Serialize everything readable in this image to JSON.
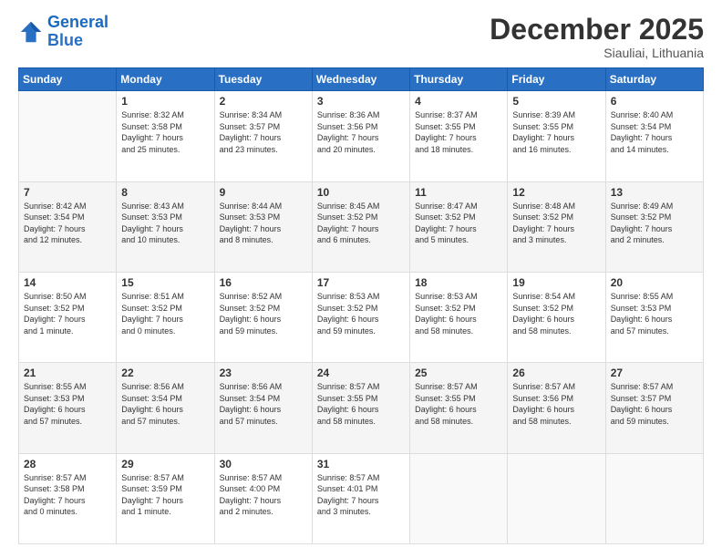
{
  "header": {
    "logo_line1": "General",
    "logo_line2": "Blue",
    "month": "December 2025",
    "location": "Siauliai, Lithuania"
  },
  "weekdays": [
    "Sunday",
    "Monday",
    "Tuesday",
    "Wednesday",
    "Thursday",
    "Friday",
    "Saturday"
  ],
  "weeks": [
    [
      {
        "day": "",
        "info": ""
      },
      {
        "day": "1",
        "info": "Sunrise: 8:32 AM\nSunset: 3:58 PM\nDaylight: 7 hours\nand 25 minutes."
      },
      {
        "day": "2",
        "info": "Sunrise: 8:34 AM\nSunset: 3:57 PM\nDaylight: 7 hours\nand 23 minutes."
      },
      {
        "day": "3",
        "info": "Sunrise: 8:36 AM\nSunset: 3:56 PM\nDaylight: 7 hours\nand 20 minutes."
      },
      {
        "day": "4",
        "info": "Sunrise: 8:37 AM\nSunset: 3:55 PM\nDaylight: 7 hours\nand 18 minutes."
      },
      {
        "day": "5",
        "info": "Sunrise: 8:39 AM\nSunset: 3:55 PM\nDaylight: 7 hours\nand 16 minutes."
      },
      {
        "day": "6",
        "info": "Sunrise: 8:40 AM\nSunset: 3:54 PM\nDaylight: 7 hours\nand 14 minutes."
      }
    ],
    [
      {
        "day": "7",
        "info": "Sunrise: 8:42 AM\nSunset: 3:54 PM\nDaylight: 7 hours\nand 12 minutes."
      },
      {
        "day": "8",
        "info": "Sunrise: 8:43 AM\nSunset: 3:53 PM\nDaylight: 7 hours\nand 10 minutes."
      },
      {
        "day": "9",
        "info": "Sunrise: 8:44 AM\nSunset: 3:53 PM\nDaylight: 7 hours\nand 8 minutes."
      },
      {
        "day": "10",
        "info": "Sunrise: 8:45 AM\nSunset: 3:52 PM\nDaylight: 7 hours\nand 6 minutes."
      },
      {
        "day": "11",
        "info": "Sunrise: 8:47 AM\nSunset: 3:52 PM\nDaylight: 7 hours\nand 5 minutes."
      },
      {
        "day": "12",
        "info": "Sunrise: 8:48 AM\nSunset: 3:52 PM\nDaylight: 7 hours\nand 3 minutes."
      },
      {
        "day": "13",
        "info": "Sunrise: 8:49 AM\nSunset: 3:52 PM\nDaylight: 7 hours\nand 2 minutes."
      }
    ],
    [
      {
        "day": "14",
        "info": "Sunrise: 8:50 AM\nSunset: 3:52 PM\nDaylight: 7 hours\nand 1 minute."
      },
      {
        "day": "15",
        "info": "Sunrise: 8:51 AM\nSunset: 3:52 PM\nDaylight: 7 hours\nand 0 minutes."
      },
      {
        "day": "16",
        "info": "Sunrise: 8:52 AM\nSunset: 3:52 PM\nDaylight: 6 hours\nand 59 minutes."
      },
      {
        "day": "17",
        "info": "Sunrise: 8:53 AM\nSunset: 3:52 PM\nDaylight: 6 hours\nand 59 minutes."
      },
      {
        "day": "18",
        "info": "Sunrise: 8:53 AM\nSunset: 3:52 PM\nDaylight: 6 hours\nand 58 minutes."
      },
      {
        "day": "19",
        "info": "Sunrise: 8:54 AM\nSunset: 3:52 PM\nDaylight: 6 hours\nand 58 minutes."
      },
      {
        "day": "20",
        "info": "Sunrise: 8:55 AM\nSunset: 3:53 PM\nDaylight: 6 hours\nand 57 minutes."
      }
    ],
    [
      {
        "day": "21",
        "info": "Sunrise: 8:55 AM\nSunset: 3:53 PM\nDaylight: 6 hours\nand 57 minutes."
      },
      {
        "day": "22",
        "info": "Sunrise: 8:56 AM\nSunset: 3:54 PM\nDaylight: 6 hours\nand 57 minutes."
      },
      {
        "day": "23",
        "info": "Sunrise: 8:56 AM\nSunset: 3:54 PM\nDaylight: 6 hours\nand 57 minutes."
      },
      {
        "day": "24",
        "info": "Sunrise: 8:57 AM\nSunset: 3:55 PM\nDaylight: 6 hours\nand 58 minutes."
      },
      {
        "day": "25",
        "info": "Sunrise: 8:57 AM\nSunset: 3:55 PM\nDaylight: 6 hours\nand 58 minutes."
      },
      {
        "day": "26",
        "info": "Sunrise: 8:57 AM\nSunset: 3:56 PM\nDaylight: 6 hours\nand 58 minutes."
      },
      {
        "day": "27",
        "info": "Sunrise: 8:57 AM\nSunset: 3:57 PM\nDaylight: 6 hours\nand 59 minutes."
      }
    ],
    [
      {
        "day": "28",
        "info": "Sunrise: 8:57 AM\nSunset: 3:58 PM\nDaylight: 7 hours\nand 0 minutes."
      },
      {
        "day": "29",
        "info": "Sunrise: 8:57 AM\nSunset: 3:59 PM\nDaylight: 7 hours\nand 1 minute."
      },
      {
        "day": "30",
        "info": "Sunrise: 8:57 AM\nSunset: 4:00 PM\nDaylight: 7 hours\nand 2 minutes."
      },
      {
        "day": "31",
        "info": "Sunrise: 8:57 AM\nSunset: 4:01 PM\nDaylight: 7 hours\nand 3 minutes."
      },
      {
        "day": "",
        "info": ""
      },
      {
        "day": "",
        "info": ""
      },
      {
        "day": "",
        "info": ""
      }
    ]
  ]
}
